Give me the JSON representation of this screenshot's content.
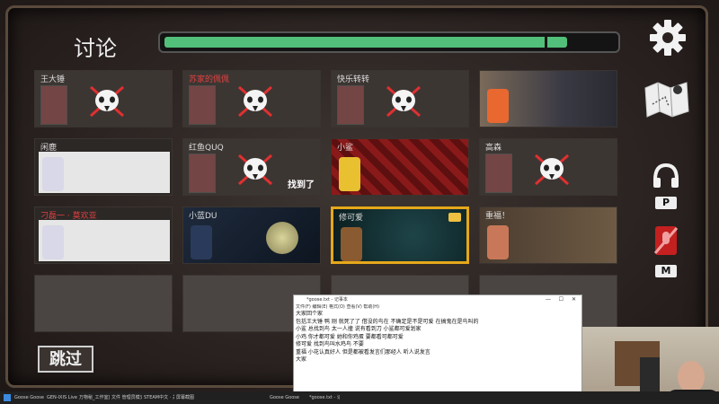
{
  "header": {
    "title": "讨论",
    "timer_progress": 0.9
  },
  "players": [
    {
      "name": "王大锤",
      "name_color": "white",
      "style": "dead",
      "dead": true
    },
    {
      "name": "苏家的佩佩",
      "name_color": "red",
      "style": "dead",
      "dead": true
    },
    {
      "name": "快乐转转",
      "name_color": "white",
      "style": "dead",
      "dead": true
    },
    {
      "name": "",
      "name_color": "white",
      "style": "gavel",
      "dead": false
    },
    {
      "name": "闲鹿",
      "name_color": "white",
      "style": "light",
      "dead": false
    },
    {
      "name": "红鱼QUQ",
      "name_color": "white",
      "style": "dead",
      "dead": true,
      "found_label": "找到了"
    },
    {
      "name": "小鲨",
      "name_color": "white",
      "style": "redpat",
      "dead": false
    },
    {
      "name": "高森",
      "name_color": "white",
      "style": "dead",
      "dead": true
    },
    {
      "name": "刁磊一 · 莫欢亚",
      "name_color": "red",
      "style": "light",
      "dead": false
    },
    {
      "name": "小蓝DU",
      "name_color": "white",
      "style": "night",
      "dead": false
    },
    {
      "name": "修可爱",
      "name_color": "white",
      "style": "water",
      "dead": false,
      "self": true
    },
    {
      "name": "重福！",
      "name_color": "white",
      "style": "cards",
      "dead": false
    },
    {
      "name": "",
      "style": "empty",
      "dead": false
    },
    {
      "name": "",
      "style": "empty",
      "dead": false
    },
    {
      "name": "",
      "style": "empty",
      "dead": false
    },
    {
      "name": "",
      "style": "empty",
      "dead": false
    }
  ],
  "side": {
    "push_to_talk_key": "P",
    "mute_key": "M"
  },
  "skip_label": "跳过",
  "notepad": {
    "title": "*goose.txt - 记事本",
    "menu": "文件(F)  编辑(E)  格式(O)  查看(V)  帮助(H)",
    "lines": [
      "大家回个家",
      "包括王大锤 鸭 刚 就死了了 借没的鸟在 不确定是不是可爱 在搞鬼在是鸟叫的",
      "小鲨 总找到鸟 太一人撞 说有看到刀 小鲨都可爱划家",
      "小鸡 你才都可爱 她和你鸡蛋 要都看可都可爱",
      "修可爱 找到鸟叫水鸡鸟 不要",
      "重福 小花认真好人 但是都被看发言们那经人 听人说发言",
      "大家"
    ]
  },
  "taskbar": {
    "items": [
      "Goose Goose Duck",
      "GEN-IXIS Live 2.0",
      "万物秘_工作室直播",
      "文件  管理员模式",
      "STEAM中文 · 关闭游戏",
      "屏幕截图",
      "Goose Goose Duck",
      "*goose.txt - 记事本"
    ]
  },
  "colors": {
    "accent_green": "#52c07a",
    "self_border": "#e6a81a",
    "dead_red": "#e03030",
    "red_name": "#e04040"
  }
}
